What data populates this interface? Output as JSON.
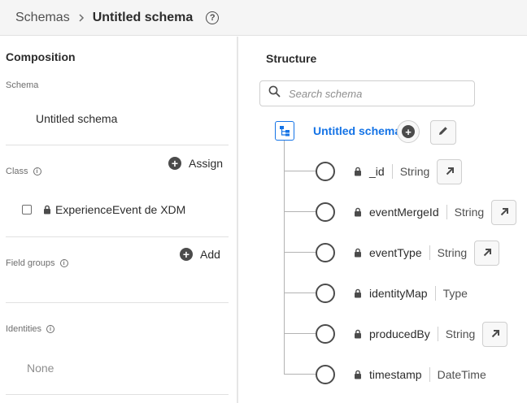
{
  "header": {
    "breadcrumb_parent": "Schemas",
    "title": "Untitled schema",
    "help_glyph": "?"
  },
  "left": {
    "composition_title": "Composition",
    "schema_label": "Schema",
    "schema_name": "Untitled schema",
    "class_label": "Class",
    "assign_label": "Assign",
    "class_item": "ExperienceEvent de XDM",
    "field_groups_label": "Field groups",
    "add_label": "Add",
    "identities_label": "Identities",
    "identities_value": "None",
    "info_glyph": "i",
    "plus_glyph": "+"
  },
  "right": {
    "structure_title": "Structure",
    "search_placeholder": "Search schema",
    "root_name": "Untitled schema",
    "fields": [
      {
        "name": "_id",
        "type": "String",
        "has_action": true
      },
      {
        "name": "eventMergeId",
        "type": "String",
        "has_action": true
      },
      {
        "name": "eventType",
        "type": "String",
        "has_action": true
      },
      {
        "name": "identityMap",
        "type": "Type",
        "has_action": false
      },
      {
        "name": "producedBy",
        "type": "String",
        "has_action": true
      },
      {
        "name": "timestamp",
        "type": "DateTime",
        "has_action": false
      }
    ]
  },
  "colors": {
    "accent": "#1473e6",
    "text": "#2c2c2c",
    "muted": "#6e6e6e",
    "border": "#cfcfcf"
  },
  "icons": [
    "chevron-right-icon",
    "help-icon",
    "info-icon",
    "plus-circle-icon",
    "lock-icon",
    "search-icon",
    "schema-tree-icon",
    "edit-pencil-icon",
    "open-link-arrow-icon",
    "field-node-icon"
  ]
}
